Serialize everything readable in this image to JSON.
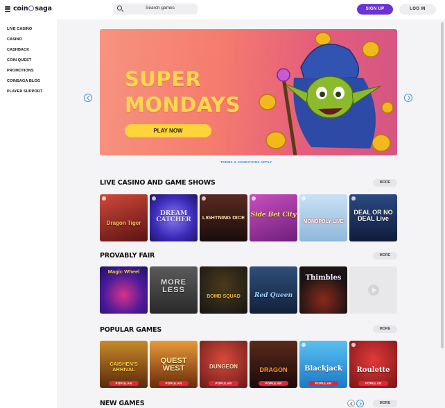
{
  "header": {
    "logo_left": "coin",
    "logo_right": "saga",
    "search_placeholder": "Search games",
    "signup_label": "SIGN UP",
    "login_label": "LOG IN"
  },
  "sidebar": {
    "items": [
      {
        "label": "LIVE CASINO"
      },
      {
        "label": "CASINO"
      },
      {
        "label": "CASHBACK"
      },
      {
        "label": "COIN QUEST"
      },
      {
        "label": "PROMOTIONS"
      },
      {
        "label": "COINSAGA BLOG"
      },
      {
        "label": "PLAYER SUPPORT"
      }
    ]
  },
  "banner": {
    "title_line1": "SUPER",
    "title_line2": "MONDAYS",
    "button_label": "PLAY NOW",
    "terms_link": "TERMS & CONDITIONS APPLY"
  },
  "sections": [
    {
      "title": "LIVE CASINO AND GAME SHOWS",
      "more": "MORE",
      "tiles": [
        {
          "name": "Dragon Tiger",
          "bg": "#8a2a2a"
        },
        {
          "name": "DREAM CATCHER",
          "bg": "#4b3bd1"
        },
        {
          "name": "LIGHTNING DICE",
          "bg": "#3a1b1b"
        },
        {
          "name": "Side Bet City",
          "bg": "#8c2f8e"
        },
        {
          "name": "MONOPOLY LIVE",
          "bg": "#9fc6e6"
        },
        {
          "name": "DEAL OR NO DEAL Live",
          "bg": "#1c2f5b"
        }
      ]
    },
    {
      "title": "PROVABLY FAIR",
      "more": "MORE",
      "tiles": [
        {
          "name": "Magic Wheel",
          "bg": "#2a2a8a"
        },
        {
          "name": "MORE LESS",
          "bg": "#4a4a4a"
        },
        {
          "name": "BOMB SQUAD",
          "bg": "#242424"
        },
        {
          "name": "Red Queen",
          "bg": "#203a5a"
        },
        {
          "name": "Thimbles",
          "bg": "#1c1c22"
        },
        {
          "name": "",
          "bg": "#e8e8eb"
        }
      ]
    },
    {
      "title": "POPULAR GAMES",
      "more": "MORE",
      "badge": "POPULAR",
      "tiles": [
        {
          "name": "CAISHEN'S ARRIVAL",
          "bg": "#6a3b14"
        },
        {
          "name": "QUEST WEST",
          "bg": "#7a3d1a"
        },
        {
          "name": "DUNGEON",
          "bg": "#b33a2a"
        },
        {
          "name": "DRAGON",
          "bg": "#3a1c14"
        },
        {
          "name": "Blackjack",
          "bg": "#2b9ee0"
        },
        {
          "name": "Roulette",
          "bg": "#c22a2a"
        }
      ]
    },
    {
      "title": "NEW GAMES",
      "more": "MORE"
    }
  ]
}
